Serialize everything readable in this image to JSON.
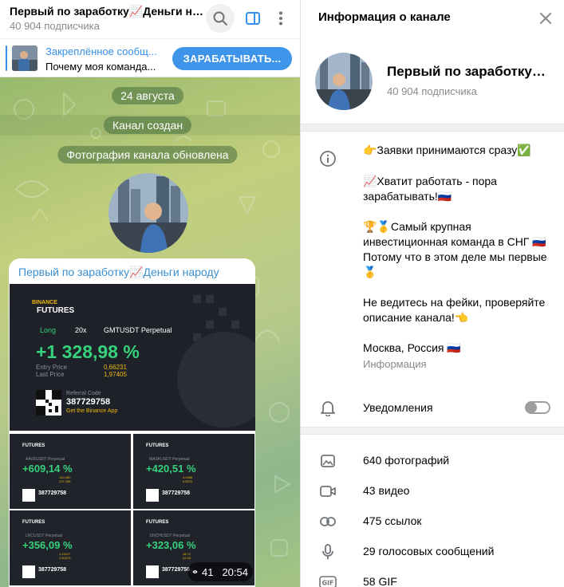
{
  "header": {
    "title": "Первый по заработку📈Деньги на...",
    "subscribers": "40 904 подписчика"
  },
  "pinned": {
    "label": "Закреплённое сообщ...",
    "text": "Почему моя команда...",
    "button": "ЗАРАБАТЫВАТЬ..."
  },
  "chat": {
    "date": "24 августа",
    "created": "Канал создан",
    "photo_updated": "Фотография канала обновлена",
    "post_author": "Первый по заработку📈Деньги народу",
    "views": "41",
    "time": "20:54"
  },
  "main_card": {
    "brand": "BINANCE",
    "product": "FUTURES",
    "side": "Long",
    "leverage": "20x",
    "pair": "GMTUSDT Perpetual",
    "pnl": "+1 328,98 %",
    "entry_label": "Entry Price",
    "last_label": "Last Price",
    "entry": "0,66231",
    "last": "1,97405",
    "ref_label": "Referral Code",
    "ref_code": "387729758",
    "cta": "Get the Binance App"
  },
  "thumbs": [
    {
      "pair": "AAVEUSDT Perpetual",
      "pnl": "+609,14 %",
      "entry": "144.460",
      "last": "237.295",
      "code": "387729758"
    },
    {
      "pair": "MASKUSDT Perpetual",
      "pnl": "+420,51 %",
      "entry": "4.4398",
      "last": "5.8370",
      "code": "387729758"
    },
    {
      "pair": "LRCUSDT Perpetual",
      "pnl": "+356,09 %",
      "entry": "1.14117",
      "last": "1.20479",
      "code": "387729758"
    },
    {
      "pair": "1INCHUSDT Perpetual",
      "pnl": "+323,06 %",
      "entry": "18.71",
      "last": "22.33",
      "code": "387729758"
    }
  ],
  "panel": {
    "title": "Информация о канале",
    "name": "Первый по заработку📈Деньги народу",
    "subscribers": "40 904 подписчика",
    "description": [
      "👉Заявки принимаются сразу✅",
      "📈Хватит работать - пора",
      "зарабатывать!🇷🇺",
      "🏆🥇Самый крупная",
      "инвестиционная команда в СНГ 🇷🇺",
      "Потому что в этом деле мы первые",
      "🥇",
      "Не ведитесь на фейки, проверяйте",
      "описание канала!👈"
    ],
    "location": "Москва, Россия 🇷🇺",
    "location_caption": "Информация",
    "notifications": "Уведомления",
    "notifications_on": false,
    "stats": {
      "photos": "640 фотографий",
      "videos": "43 видео",
      "links": "475 ссылок",
      "voice": "29 голосовых сообщений",
      "gif": "58 GIF"
    }
  },
  "colors": {
    "accent": "#3390ec",
    "profit_green": "#36d17c",
    "binance_yellow": "#f0b90b"
  }
}
